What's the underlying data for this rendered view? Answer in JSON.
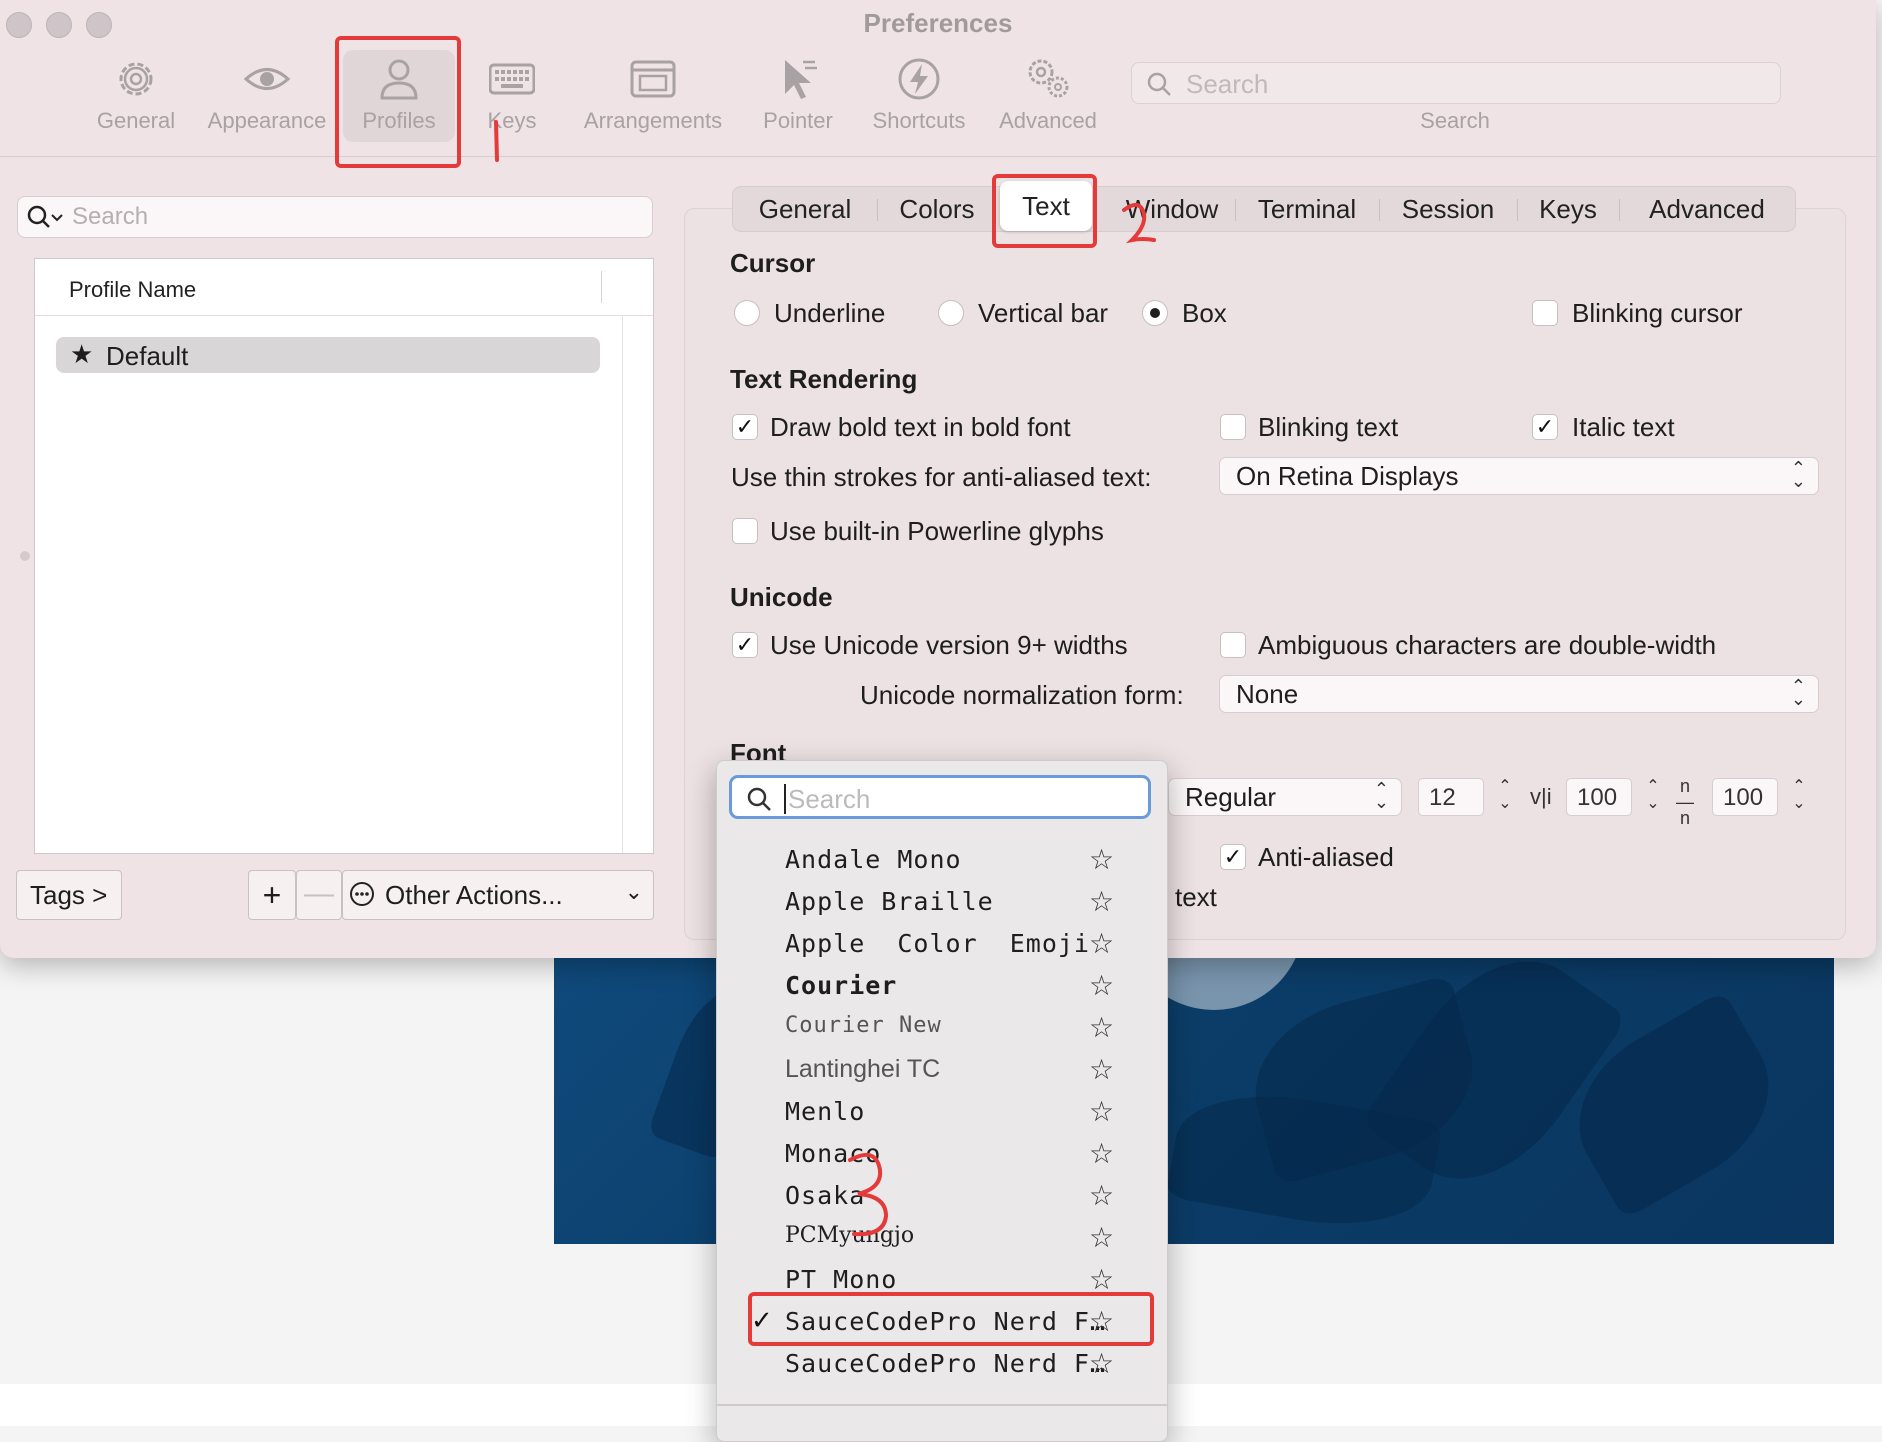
{
  "window": {
    "title": "Preferences"
  },
  "toolbar": {
    "items": [
      {
        "label": "General",
        "icon": "gear-icon"
      },
      {
        "label": "Appearance",
        "icon": "eye-icon"
      },
      {
        "label": "Profiles",
        "icon": "person-icon",
        "selected": true
      },
      {
        "label": "Keys",
        "icon": "keyboard-icon"
      },
      {
        "label": "Arrangements",
        "icon": "windows-icon"
      },
      {
        "label": "Pointer",
        "icon": "pointer-icon"
      },
      {
        "label": "Shortcuts",
        "icon": "bolt-icon"
      },
      {
        "label": "Advanced",
        "icon": "gears-icon"
      }
    ],
    "search_placeholder": "Search",
    "search_caption": "Search"
  },
  "sidebar": {
    "search_placeholder": "Search",
    "column_header": "Profile Name",
    "profiles": [
      {
        "name": "Default",
        "is_default": true,
        "selected": true
      }
    ],
    "tags_button": "Tags >",
    "add_button": "+",
    "remove_button": "—",
    "other_actions_button": "Other Actions..."
  },
  "tabs": {
    "items": [
      "General",
      "Colors",
      "Text",
      "Window",
      "Terminal",
      "Session",
      "Keys",
      "Advanced"
    ],
    "active": "Text"
  },
  "cursor": {
    "title": "Cursor",
    "underline": "Underline",
    "vertical_bar": "Vertical bar",
    "box": "Box",
    "selected": "Box",
    "blinking_cursor": "Blinking cursor",
    "blinking_cursor_checked": false
  },
  "text_rendering": {
    "title": "Text Rendering",
    "bold_font": "Draw bold text in bold font",
    "bold_font_checked": true,
    "blinking_text": "Blinking text",
    "blinking_text_checked": false,
    "italic_text": "Italic text",
    "italic_text_checked": true,
    "thin_strokes_label": "Use thin strokes for anti-aliased text:",
    "thin_strokes_value": "On Retina Displays",
    "powerline": "Use built-in Powerline glyphs",
    "powerline_checked": false
  },
  "unicode": {
    "title": "Unicode",
    "v9_widths": "Use Unicode version 9+ widths",
    "v9_widths_checked": true,
    "ambiguous": "Ambiguous characters are double-width",
    "ambiguous_checked": false,
    "normalization_label": "Unicode normalization form:",
    "normalization_value": "None"
  },
  "font": {
    "title": "Font",
    "style": "Regular",
    "size": "12",
    "vertical_spacing": "100",
    "horizontal_spacing": "100",
    "anti_aliased": "Anti-aliased",
    "anti_aliased_checked": true,
    "partial_label": "l text",
    "vertical_spacing_glyph": "v|i",
    "horizontal_spacing_glyph": "n/n"
  },
  "font_menu": {
    "search_placeholder": "Search",
    "items": [
      {
        "name": "Andale Mono",
        "style": "mono"
      },
      {
        "name": "Apple Braille",
        "style": "mono"
      },
      {
        "name": "Apple  Color  Emoji",
        "style": "mono"
      },
      {
        "name": "Courier",
        "style": "mono"
      },
      {
        "name": "Courier New",
        "style": "mono-light"
      },
      {
        "name": "Lantinghei TC",
        "style": "sans"
      },
      {
        "name": "Menlo",
        "style": "mono"
      },
      {
        "name": "Monaco",
        "style": "mono"
      },
      {
        "name": "Osaka",
        "style": "mono"
      },
      {
        "name": "PCMyungjo",
        "style": "serif"
      },
      {
        "name": "PT Mono",
        "style": "mono"
      },
      {
        "name": "SauceCodePro Nerd F…",
        "style": "mono",
        "checked": true
      },
      {
        "name": "SauceCodePro Nerd F…",
        "style": "mono"
      }
    ],
    "check_mark": "✓",
    "favorite_glyph": "☆"
  },
  "annotations": {
    "color": "#e53a3a",
    "step_1": "1",
    "step_2": "2",
    "step_3": "3"
  },
  "colors": {
    "window_bg": "#efe3e5",
    "focus_ring": "#6a9bd8",
    "background_art": "#0f4a7c"
  }
}
